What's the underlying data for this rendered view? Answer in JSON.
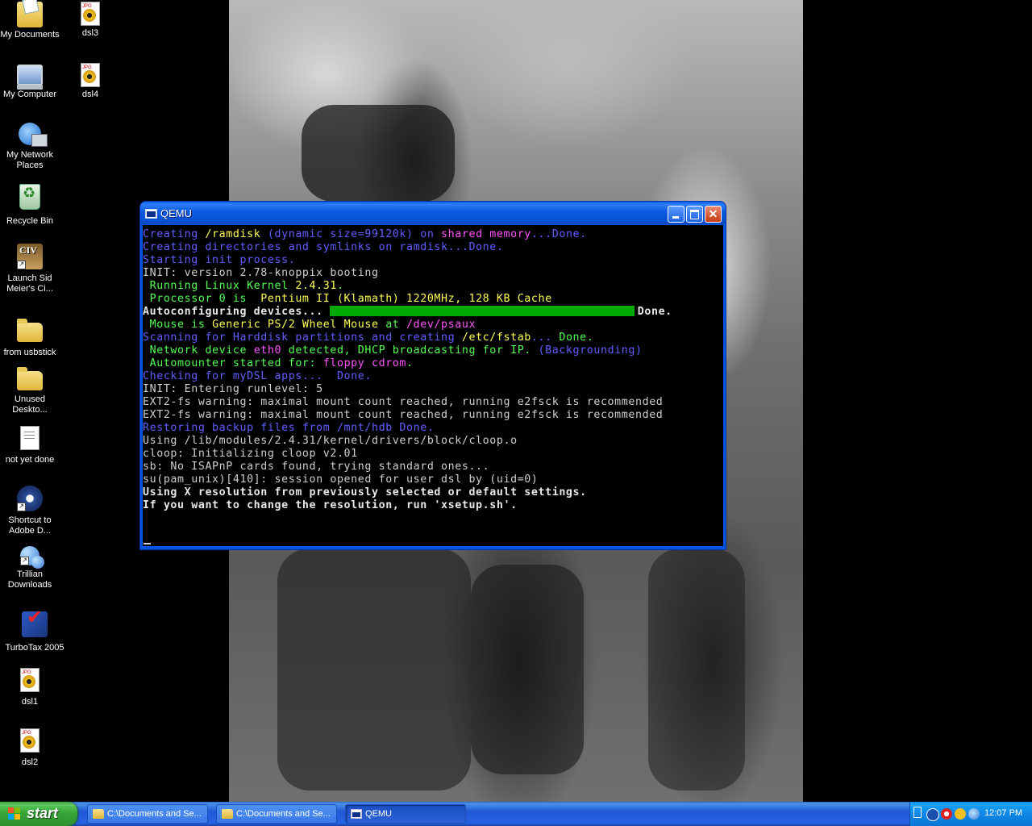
{
  "desktop": {
    "icons": [
      {
        "label": "My Documents",
        "icon": "my-documents-icon"
      },
      {
        "label": "dsl3",
        "icon": "jpg-file-icon"
      },
      {
        "label": "My Computer",
        "icon": "my-computer-icon"
      },
      {
        "label": "dsl4",
        "icon": "jpg-file-icon"
      },
      {
        "label": "My Network Places",
        "icon": "network-places-icon"
      },
      {
        "label": "Recycle Bin",
        "icon": "recycle-bin-icon"
      },
      {
        "label": "Launch Sid Meier's Ci...",
        "icon": "civilization-icon"
      },
      {
        "label": "from usbstick",
        "icon": "folder-icon"
      },
      {
        "label": "Unused Deskto...",
        "icon": "folder-icon"
      },
      {
        "label": "not yet done",
        "icon": "text-document-icon"
      },
      {
        "label": "Shortcut to Adobe D...",
        "icon": "adobe-icon"
      },
      {
        "label": "Trillian Downloads",
        "icon": "trillian-icon"
      },
      {
        "label": "TurboTax 2005",
        "icon": "turbotax-icon"
      },
      {
        "label": "dsl1",
        "icon": "jpg-file-icon"
      },
      {
        "label": "dsl2",
        "icon": "jpg-file-icon"
      }
    ]
  },
  "qemu": {
    "title": "QEMU",
    "console": [
      [
        {
          "c": "blue",
          "t": "Creating "
        },
        {
          "c": "yellow",
          "t": "/ramdisk"
        },
        {
          "c": "blue",
          "t": " (dynamic size=99120k) on "
        },
        {
          "c": "magenta",
          "t": "shared memory"
        },
        {
          "c": "blue",
          "t": "...Done."
        }
      ],
      [
        {
          "c": "blue",
          "t": "Creating directories and symlinks on ramdisk...Done."
        }
      ],
      [
        {
          "c": "blue",
          "t": "Starting init process."
        }
      ],
      [
        {
          "c": "gray",
          "t": "INIT: version 2.78-knoppix booting"
        }
      ],
      [
        {
          "c": "green",
          "t": " Running Linux Kernel "
        },
        {
          "c": "yellow",
          "t": "2.4.31"
        },
        {
          "c": "green",
          "t": "."
        }
      ],
      [
        {
          "c": "green",
          "t": " Processor 0 is  "
        },
        {
          "c": "yellow",
          "t": "Pentium II (Klamath) 1220MHz, 128 KB Cache"
        }
      ],
      [
        {
          "c": "white",
          "t": "Autoconfiguring devices..."
        },
        {
          "c": "progress",
          "t": "100"
        },
        {
          "c": "white",
          "t": "Done."
        }
      ],
      [
        {
          "c": "green",
          "t": " Mouse is "
        },
        {
          "c": "yellow",
          "t": "Generic PS/2 Wheel Mouse"
        },
        {
          "c": "green",
          "t": " at "
        },
        {
          "c": "magenta",
          "t": "/dev/psaux"
        }
      ],
      [
        {
          "c": "blue",
          "t": "Scanning for Harddisk partitions and creating "
        },
        {
          "c": "yellow",
          "t": "/etc/fstab"
        },
        {
          "c": "blue",
          "t": "... "
        },
        {
          "c": "green",
          "t": "Done."
        }
      ],
      [
        {
          "c": "green",
          "t": " Network device "
        },
        {
          "c": "magenta",
          "t": "eth0"
        },
        {
          "c": "green",
          "t": " detected, DHCP broadcasting for IP. "
        },
        {
          "c": "blue",
          "t": "(Backgrounding)"
        }
      ],
      [
        {
          "c": "green",
          "t": " Automounter started for: "
        },
        {
          "c": "magenta",
          "t": "floppy cdrom"
        },
        {
          "c": "green",
          "t": "."
        }
      ],
      [
        {
          "c": "blue",
          "t": "Checking for myDSL apps...  Done."
        }
      ],
      [
        {
          "c": "gray",
          "t": "INIT: Entering runlevel: 5"
        }
      ],
      [
        {
          "c": "gray",
          "t": "EXT2-fs warning: maximal mount count reached, running e2fsck is recommended"
        }
      ],
      [
        {
          "c": "gray",
          "t": "EXT2-fs warning: maximal mount count reached, running e2fsck is recommended"
        }
      ],
      [
        {
          "c": "blue",
          "t": "Restoring backup files from /mnt/hdb Done."
        }
      ],
      [
        {
          "c": "gray",
          "t": "Using /lib/modules/2.4.31/kernel/drivers/block/cloop.o"
        }
      ],
      [
        {
          "c": "gray",
          "t": "cloop: Initializing cloop v2.01"
        }
      ],
      [
        {
          "c": "gray",
          "t": "sb: No ISAPnP cards found, trying standard ones..."
        }
      ],
      [
        {
          "c": "gray",
          "t": "su(pam_unix)[410]: session opened for user dsl by (uid=0)"
        }
      ],
      [
        {
          "c": "white",
          "t": "Using X resolution from previously selected or default settings."
        }
      ],
      [
        {
          "c": "white",
          "t": "If you want to change the resolution, run 'xsetup.sh'."
        }
      ]
    ]
  },
  "taskbar": {
    "start_label": "start",
    "tasks": [
      {
        "label": "C:\\Documents and Se...",
        "icon": "folder-icon"
      },
      {
        "label": "C:\\Documents and Se...",
        "icon": "folder-icon"
      },
      {
        "label": "QEMU",
        "icon": "qemu-window-icon"
      }
    ],
    "clock": "12:07 PM"
  }
}
